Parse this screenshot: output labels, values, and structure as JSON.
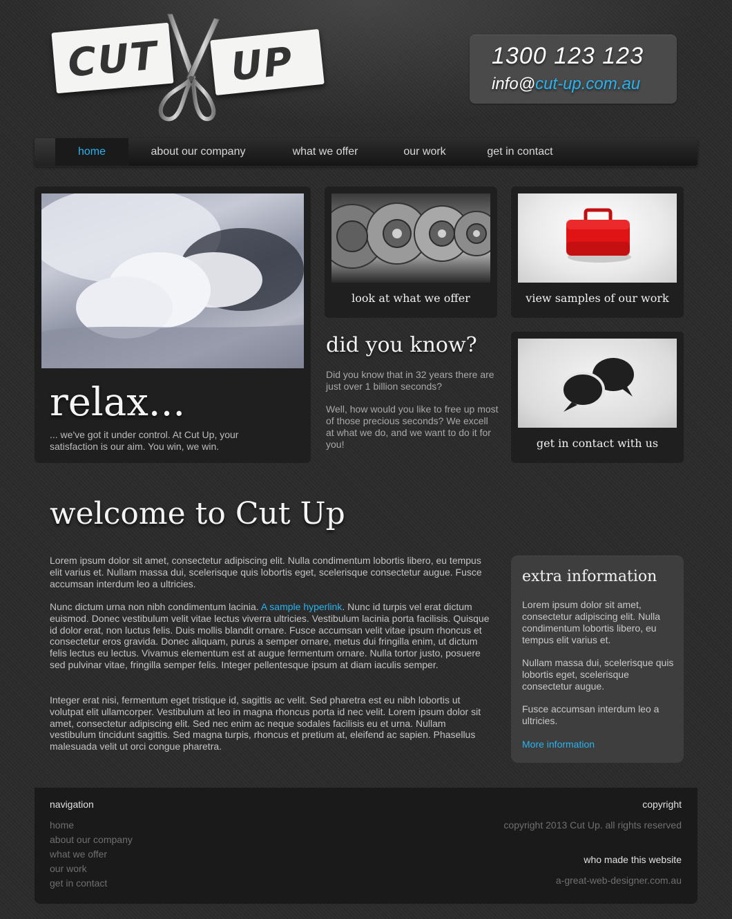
{
  "logo": {
    "left_word": "CUT",
    "right_word": "UP",
    "icon": "scissors-icon"
  },
  "contact": {
    "phone": "1300 123 123",
    "email_prefix": "info@",
    "email_domain": "cut-up.com.au"
  },
  "nav": {
    "items": [
      {
        "label": "home",
        "active": true
      },
      {
        "label": "about our company"
      },
      {
        "label": "what we offer"
      },
      {
        "label": "our work"
      },
      {
        "label": "get in contact"
      }
    ]
  },
  "relax": {
    "title": "relax...",
    "text": "... we've got it under control. At Cut Up, your satisfaction is our aim. You win, we win."
  },
  "tiles": {
    "offer_caption": "look at what we offer",
    "work_caption": "view samples of our work",
    "contact_caption": "get in contact with us"
  },
  "did_you_know": {
    "title": "did you know?",
    "p1": "Did you know that in 32 years there are just over 1 billion seconds?",
    "p2": "Well, how would you like to free up most of those precious seconds? We excell at what we do, and we want to do it for  you!"
  },
  "welcome": {
    "title": "welcome to Cut Up",
    "p1": "Lorem ipsum dolor sit amet, consectetur adipiscing elit. Nulla condimentum lobortis libero, eu tempus elit varius et. Nullam massa dui, scelerisque quis lobortis eget, scelerisque consectetur augue. Fusce accumsan interdum leo a ultricies.",
    "p2_before": "Nunc dictum urna non nibh condimentum lacinia. ",
    "p2_link": "A sample hyperlink",
    "p2_after": ". Nunc id turpis vel erat dictum euismod. Donec vestibulum velit vitae lectus viverra ultricies. Vestibulum lacinia porta facilisis. Quisque id dolor erat, non luctus felis. Duis mollis blandit ornare. Fusce accumsan velit vitae ipsum rhoncus et consectetur eros gravida. Donec aliquam, purus a semper ornare, metus dui fringilla enim, ut dictum felis lectus eu lectus. Vivamus elementum est at augue fermentum ornare. Nulla tortor justo, posuere sed pulvinar vitae, fringilla semper felis. Integer pellentesque ipsum at diam iaculis semper.",
    "p3": "Integer erat nisi, fermentum eget tristique id, sagittis ac velit. Sed pharetra est eu nibh lobortis ut volutpat elit ullamcorper. Vestibulum at leo in magna rhoncus porta id nec velit. Lorem ipsum dolor sit amet, consectetur adipiscing elit. Sed nec enim ac neque sodales facilisis eu et urna. Nullam vestibulum tincidunt sagittis. Sed magna turpis, rhoncus et pretium at, eleifend ac sapien. Phasellus malesuada velit ut orci congue pharetra."
  },
  "extra": {
    "title": "extra information",
    "p1": "Lorem ipsum dolor sit amet, consectetur adipiscing elit. Nulla condimentum lobortis libero, eu tempus elit varius et.",
    "p2": "Nullam massa dui, scelerisque quis lobortis eget, scelerisque consectetur augue.",
    "p3": "Fusce accumsan interdum leo a ultricies.",
    "more": "More information"
  },
  "footer": {
    "nav_title": "navigation",
    "links": [
      "home",
      "about our company",
      "what we offer",
      "our work",
      "get in contact"
    ],
    "copyright_title": "copyright",
    "copyright_text": "copyright 2013 Cut Up. all rights reserved",
    "made_title": "who made this website",
    "made_link": "a-great-web-designer.com.au"
  },
  "colors": {
    "accent": "#29b3ee",
    "background": "#2b2b2b",
    "panel": "#1f1f1f",
    "footer": "#1a1a1a"
  }
}
